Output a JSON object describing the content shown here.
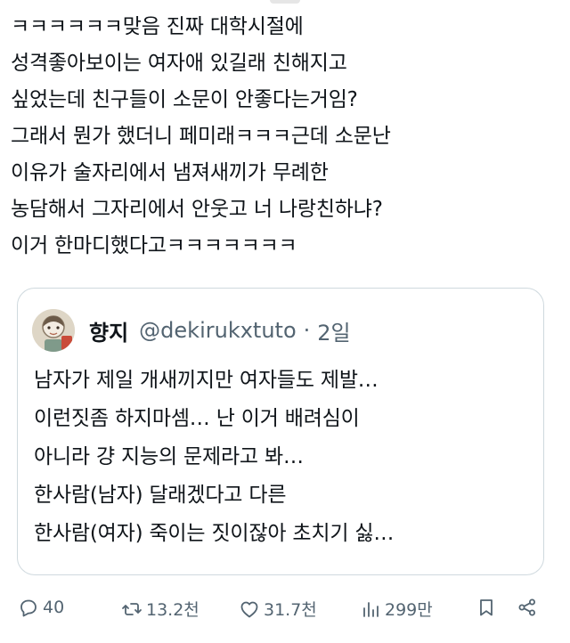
{
  "tweet": {
    "lines": [
      "ㅋㅋㅋㅋㅋㅋ맞음 진짜 대학시절에",
      "성격좋아보이는 여자애 있길래 친해지고",
      "싶었는데 친구들이 소문이 안좋다는거임?",
      "그래서 뭔가 했더니 페미래ㅋㅋㅋ근데 소문난",
      "이유가 술자리에서 냄져새끼가 무례한",
      "농담해서 그자리에서 안웃고 너 나랑친하냐?",
      "이거 한마디했다고ㅋㅋㅋㅋㅋㅋㅋ"
    ]
  },
  "quote": {
    "author_name": "향지",
    "handle": "@dekirukxtuto",
    "separator": "·",
    "time": "2일",
    "lines": [
      "남자가 제일 개새끼지만 여자들도 제발…",
      "이런짓좀 하지마셈… 난 이거 배려심이",
      "아니라 걍 지능의 문제라고 봐…",
      "한사람(남자) 달래겠다고 다른",
      "한사람(여자) 죽이는 짓이잖아 초치기 싫…"
    ]
  },
  "actions": {
    "reply": {
      "icon": "reply-icon",
      "count": "40"
    },
    "retweet": {
      "icon": "retweet-icon",
      "count": "13.2천"
    },
    "like": {
      "icon": "heart-icon",
      "count": "31.7천"
    },
    "views": {
      "icon": "views-icon",
      "count": "299만"
    },
    "bookmark": {
      "icon": "bookmark-icon"
    },
    "share": {
      "icon": "share-icon"
    }
  },
  "colors": {
    "text": "#0f1419",
    "muted": "#536471",
    "border": "#cfd9de"
  }
}
